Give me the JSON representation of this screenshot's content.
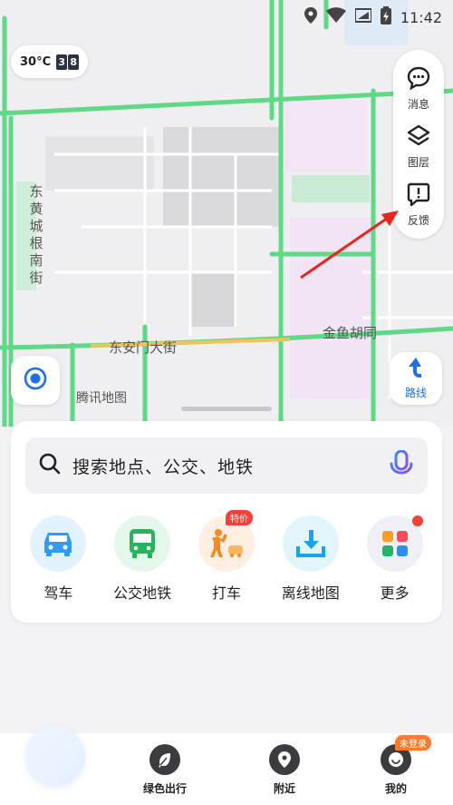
{
  "status_bar": {
    "time": "11:42"
  },
  "weather": {
    "temperature": "30°C",
    "aqi_digits": [
      "3",
      "8"
    ]
  },
  "map_tools": [
    {
      "label": "消息",
      "icon": "message-icon"
    },
    {
      "label": "图层",
      "icon": "layers-icon"
    },
    {
      "label": "反馈",
      "icon": "feedback-icon"
    }
  ],
  "map_labels": {
    "street_vertical": "东黄城根南街",
    "street_east_an": "东安门大街",
    "hutong": "金鱼胡同",
    "provider": "腾讯地图"
  },
  "route_button": {
    "label": "路线"
  },
  "search": {
    "placeholder": "搜索地点、公交、地铁"
  },
  "quick_actions": [
    {
      "label": "驾车",
      "icon": "car-icon",
      "bg": "#e7f5ff"
    },
    {
      "label": "公交地铁",
      "icon": "bus-icon",
      "bg": "#e6f8ec"
    },
    {
      "label": "打车",
      "icon": "taxi-icon",
      "bg": "#fff1e5",
      "badge": "特价"
    },
    {
      "label": "离线地图",
      "icon": "download-icon",
      "bg": "#e7f7fc"
    },
    {
      "label": "更多",
      "icon": "more-apps-icon",
      "bg": "#f1f1f6"
    }
  ],
  "bottom_nav": [
    {
      "label": "",
      "icon": "home-icon"
    },
    {
      "label": "绿色出行",
      "icon": "leaf-icon"
    },
    {
      "label": "附近",
      "icon": "location-pin-icon"
    },
    {
      "label": "我的",
      "icon": "profile-icon",
      "badge": "未登录"
    }
  ],
  "colors": {
    "road_green": "#5fd986",
    "accent_blue": "#1f6fe5",
    "badge_red": "#f0413b",
    "arrow_red": "#e8261d"
  }
}
